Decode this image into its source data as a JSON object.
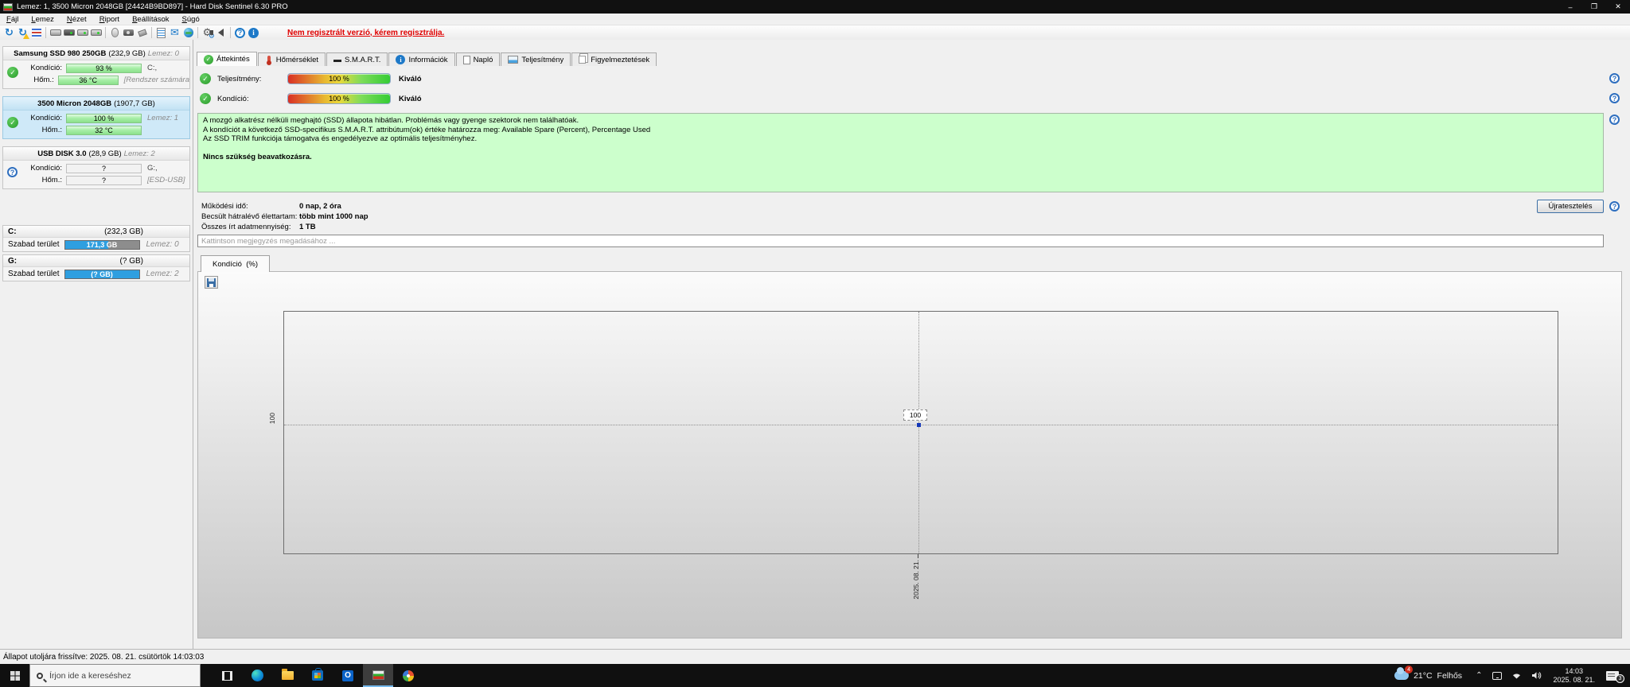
{
  "window": {
    "title": "Lemez: 1, 3500 Micron 2048GB [24424B9BD897]  -  Hard Disk Sentinel 6.30 PRO",
    "controls": {
      "minimize": "–",
      "maximize": "❐",
      "close": "✕"
    }
  },
  "menu": {
    "items": [
      {
        "label": "Fájl"
      },
      {
        "label": "Lemez"
      },
      {
        "label": "Nézet"
      },
      {
        "label": "Riport"
      },
      {
        "label": "Beállítások"
      },
      {
        "label": "Súgó"
      }
    ]
  },
  "toolbar": {
    "icons": [
      "refresh-icon",
      "reanalyse-warning-icon",
      "report-icon",
      "disk-gray-icon",
      "disk-dark-icon",
      "disk-green-icon",
      "disk-green2-icon",
      "mouse-icon",
      "camera-icon",
      "usb-device-icon",
      "notes-icon",
      "email-icon",
      "network-icon",
      "settings-gears-icon",
      "sound-icon",
      "help-icon",
      "info-icon"
    ],
    "register_notice": "Nem regisztrált verzió, kérem regisztrálja."
  },
  "sidebar": {
    "disks": [
      {
        "name": "Samsung SSD 980 250GB",
        "size": "(232,9 GB)",
        "disk_label": "Lemez: 0",
        "condition_label": "Kondíció:",
        "condition_value": "93 %",
        "condition_right": "C:,",
        "temp_label": "Hőm.:",
        "temp_value": "36 °C",
        "temp_right": "[Rendszer számára"
      },
      {
        "name": "3500 Micron 2048GB",
        "size": "(1907,7 GB)",
        "disk_label": "",
        "condition_label": "Kondíció:",
        "condition_value": "100 %",
        "condition_right": "Lemez: 1",
        "temp_label": "Hőm.:",
        "temp_value": "32 °C",
        "temp_right": ""
      },
      {
        "name": "USB DISK 3.0",
        "size": "(28,9 GB)",
        "disk_label": "Lemez: 2",
        "condition_label": "Kondíció:",
        "condition_value": "?",
        "condition_right": "G:,",
        "temp_label": "Hőm.:",
        "temp_value": "?",
        "temp_right": "[ESD-USB]"
      }
    ],
    "partitions": [
      {
        "name": "C:",
        "size": "(232,3 GB)",
        "free_label": "Szabad terület",
        "free_value": "171,3 GB",
        "disk_label": "Lemez: 0"
      },
      {
        "name": "G:",
        "size": "(? GB)",
        "free_label": "Szabad terület",
        "free_value": "(? GB)",
        "disk_label": "Lemez: 2"
      }
    ]
  },
  "tabs": [
    {
      "label": "Áttekintés"
    },
    {
      "label": "Hőmérséklet"
    },
    {
      "label": "S.M.A.R.T."
    },
    {
      "label": "Információk"
    },
    {
      "label": "Napló"
    },
    {
      "label": "Teljesítmény"
    },
    {
      "label": "Figyelmeztetések"
    }
  ],
  "overview": {
    "performance_label": "Teljesítmény:",
    "performance_value": "100 %",
    "performance_rating": "Kiváló",
    "condition_label": "Kondíció:",
    "condition_value": "100 %",
    "condition_rating": "Kiváló",
    "description_lines": [
      "A mozgó alkatrész nélküli meghajtó (SSD) állapota hibátlan. Problémás vagy gyenge szektorok nem találhatóak.",
      "A kondíciót a következő SSD-specifikus S.M.A.R.T. attribútum(ok) értéke határozza meg:  Available Spare (Percent), Percentage Used",
      "Az SSD TRIM funkciója támogatva és engedélyezve az optimális teljesítményhez."
    ],
    "action_text": "Nincs szükség beavatkozásra.",
    "stats": [
      {
        "label": "Működési idő:",
        "value": "0 nap, 2 óra"
      },
      {
        "label": "Becsült hátralévő élettartam:",
        "value": "több mint 1000 nap"
      },
      {
        "label": "Összes írt adatmennyiség:",
        "value": "1 TB"
      }
    ],
    "retest_button": "Újratesztelés",
    "comment_placeholder": "Kattintson megjegyzés megadásához ..."
  },
  "history": {
    "tab_label": "Kondíció  (%)",
    "y_label": "100",
    "point_label": "100",
    "x_label": "2025. 08. 21."
  },
  "statusbar": {
    "text": "Állapot utoljára frissítve: 2025. 08. 21. csütörtök 14:03:03"
  },
  "taskbar": {
    "search_placeholder": "Írjon ide a kereséshez",
    "weather": {
      "badge": "4",
      "temp": "21°C",
      "desc": "Felhős"
    },
    "clock": {
      "time": "14:03",
      "date": "2025. 08. 21."
    },
    "notification_badge": "3"
  },
  "chart_data": {
    "type": "line",
    "title": "Kondíció (%)",
    "x": [
      "2025. 08. 21."
    ],
    "series": [
      {
        "name": "Kondíció",
        "values": [
          100
        ]
      }
    ],
    "xlabel": "",
    "ylabel": "Kondíció (%)",
    "y_gridlines": [
      100
    ],
    "legend": false,
    "grid": "dotted"
  }
}
